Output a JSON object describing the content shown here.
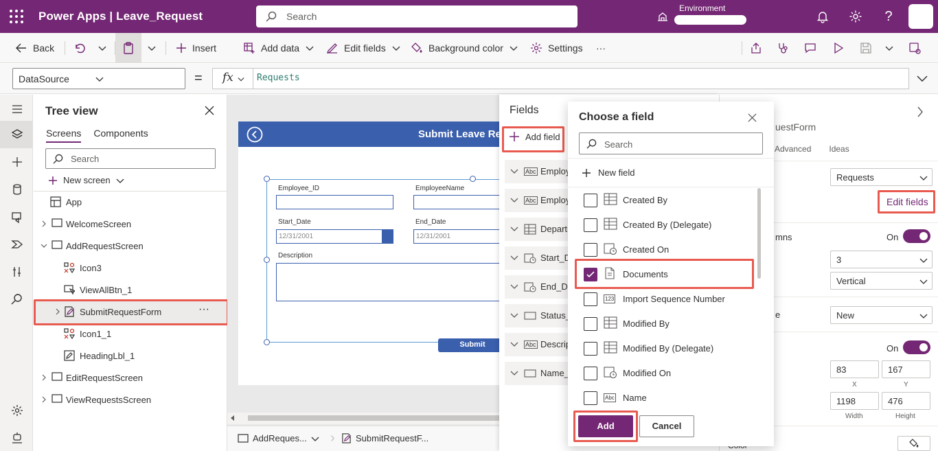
{
  "header": {
    "app_name": "Power Apps  |  Leave_Request",
    "search_placeholder": "Search",
    "environment_label": "Environment"
  },
  "cmdbar": {
    "back": "Back",
    "insert": "Insert",
    "add_data": "Add data",
    "edit_fields": "Edit fields",
    "background_color": "Background color",
    "settings": "Settings",
    "more": "···"
  },
  "formula": {
    "property": "DataSource",
    "equals": "=",
    "fx": "fx",
    "expression": "Requests"
  },
  "tree": {
    "title": "Tree view",
    "tabs": [
      "Screens",
      "Components"
    ],
    "search_placeholder": "Search",
    "new_screen": "New screen",
    "nodes": [
      "App",
      "WelcomeScreen",
      "AddRequestScreen",
      "Icon3",
      "ViewAllBtn_1",
      "SubmitRequestForm",
      "Icon1_1",
      "HeadingLbl_1",
      "EditRequestScreen",
      "ViewRequestsScreen"
    ],
    "more": "···"
  },
  "canvas": {
    "screen_title": "Submit Leave Re",
    "labels": [
      "Employee_ID",
      "EmployeeName",
      "Start_Date",
      "End_Date",
      "Description"
    ],
    "start_date_value": "12/31/2001",
    "end_date_value": "12/31/2001",
    "submit": "Submit"
  },
  "bottombar": {
    "screen": "AddReques...",
    "control": "SubmitRequestF..."
  },
  "fields_panel": {
    "title": "Fields",
    "add_field": "Add field",
    "rows": [
      "Employe",
      "Employe",
      "Departm",
      "Start_Da",
      "End_Dat",
      "Status_D",
      "Descript",
      "Name_D"
    ]
  },
  "dialog": {
    "title": "Choose a field",
    "search_placeholder": "Search",
    "new_field": "New field",
    "items": [
      {
        "label": "Created By",
        "checked": false,
        "icon": "lookup-icon"
      },
      {
        "label": "Created By (Delegate)",
        "checked": false,
        "icon": "lookup-icon"
      },
      {
        "label": "Created On",
        "checked": false,
        "icon": "datetime-icon"
      },
      {
        "label": "Documents",
        "checked": true,
        "icon": "document-icon"
      },
      {
        "label": "Import Sequence Number",
        "checked": false,
        "icon": "number-icon"
      },
      {
        "label": "Modified By",
        "checked": false,
        "icon": "lookup-icon"
      },
      {
        "label": "Modified By (Delegate)",
        "checked": false,
        "icon": "lookup-icon"
      },
      {
        "label": "Modified On",
        "checked": false,
        "icon": "datetime-icon"
      },
      {
        "label": "Name",
        "checked": false,
        "icon": "text-icon"
      }
    ],
    "add": "Add",
    "cancel": "Cancel"
  },
  "props": {
    "control_name": "uestForm",
    "tabs": [
      "Advanced",
      "Ideas"
    ],
    "data_source": "Requests",
    "edit_fields": "Edit fields",
    "columns_label": "mns",
    "columns_toggle": "On",
    "columns": "3",
    "layout": "Vertical",
    "mode_label": "e",
    "mode": "New",
    "visible_toggle": "On",
    "x": "83",
    "y": "167",
    "x_label": "X",
    "y_label": "Y",
    "width": "1198",
    "height": "476",
    "width_label": "Width",
    "height_label": "Height",
    "color_label": "Color"
  },
  "colors": {
    "brand": "#742774",
    "screen_header": "#3a5fad",
    "highlight": "#e85a4f"
  }
}
